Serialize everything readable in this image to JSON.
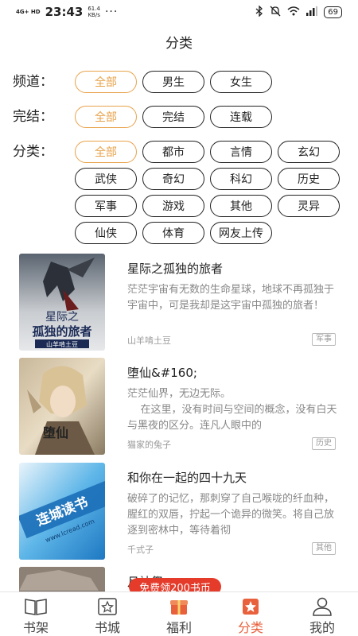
{
  "status": {
    "network": "4G+ HD",
    "time": "23:43",
    "speed_value": "61.4",
    "speed_unit": "KB/s",
    "dots": "···",
    "battery": "69"
  },
  "page_title": "分类",
  "filters": {
    "channel": {
      "label": "频道：",
      "options": [
        "全部",
        "男生",
        "女生"
      ],
      "active": "全部"
    },
    "status": {
      "label": "完结：",
      "options": [
        "全部",
        "完结",
        "连载"
      ],
      "active": "全部"
    },
    "category": {
      "label": "分类：",
      "options": [
        "全部",
        "都市",
        "言情",
        "玄幻",
        "武侠",
        "奇幻",
        "科幻",
        "历史",
        "军事",
        "游戏",
        "其他",
        "灵异",
        "仙侠",
        "体育",
        "网友上传"
      ],
      "active": "全部"
    }
  },
  "books": [
    {
      "title": "星际之孤独的旅者",
      "description": "茫茫宇宙有无数的生命星球，地球不再孤独于宇宙中，可是我却是这宇宙中孤独的旅者！",
      "author": "山羊啃土豆",
      "tag": "军事",
      "cover_text_top": "星际之",
      "cover_text_main": "孤独的旅者",
      "cover_text_author": "山羊啃土豆"
    },
    {
      "title": "堕仙&#160;",
      "description": "茫茫仙界，无边无际。\n    在这里，没有时间与空间的概念，没有白天与黑夜的区分。连凡人眼中的",
      "author": "猫家的兔子",
      "tag": "历史",
      "cover_text_main": "堕仙"
    },
    {
      "title": "和你在一起的四十九天",
      "description": "破碎了的记忆，那刺穿了自己喉咙的纤血种，腥红的双唇，拧起一个诡异的微笑。将自己放逐到密林中，等待着彻",
      "author": "千式子",
      "tag": "其他",
      "cover_text_main": "连城读书",
      "cover_text_url": "www.lcread.com"
    },
    {
      "title": "月神祭"
    }
  ],
  "promo_badge": "免费领200书币",
  "tabs": [
    {
      "label": "书架",
      "icon": "bookshelf-icon",
      "active": false
    },
    {
      "label": "书城",
      "icon": "bookstore-icon",
      "active": false
    },
    {
      "label": "福利",
      "icon": "gift-icon",
      "active": false
    },
    {
      "label": "分类",
      "icon": "category-star-icon",
      "active": true
    },
    {
      "label": "我的",
      "icon": "profile-icon",
      "active": false
    }
  ],
  "colors": {
    "accent": "#e8a24a",
    "tab_active": "#e8603c",
    "promo": "#e43b2b"
  }
}
